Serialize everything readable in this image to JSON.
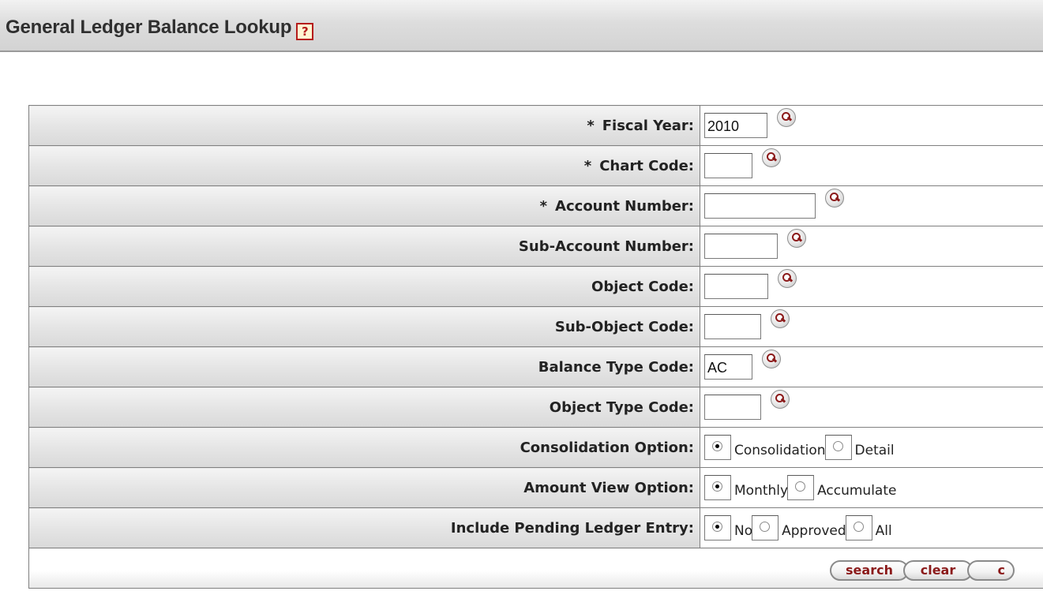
{
  "page": {
    "title": "General Ledger Balance Lookup",
    "help_icon": "?"
  },
  "form": {
    "rows": [
      {
        "label": "Fiscal Year:",
        "required": true,
        "value": "2010"
      },
      {
        "label": "Chart Code:",
        "required": true,
        "value": ""
      },
      {
        "label": "Account Number:",
        "required": true,
        "value": ""
      },
      {
        "label": "Sub-Account Number:",
        "required": false,
        "value": ""
      },
      {
        "label": "Object Code:",
        "required": false,
        "value": ""
      },
      {
        "label": "Sub-Object Code:",
        "required": false,
        "value": ""
      },
      {
        "label": "Balance Type Code:",
        "required": false,
        "value": "AC"
      },
      {
        "label": "Object Type Code:",
        "required": false,
        "value": ""
      }
    ],
    "required_marker": "*",
    "consolidation": {
      "label": "Consolidation Option:",
      "options": [
        "Consolidation",
        "Detail"
      ],
      "selected": "Consolidation"
    },
    "amount_view": {
      "label": "Amount View Option:",
      "options": [
        "Monthly",
        "Accumulate"
      ],
      "selected": "Monthly"
    },
    "pending": {
      "label": "Include Pending Ledger Entry:",
      "options": [
        "No",
        "Approved",
        "All"
      ],
      "selected": "No"
    }
  },
  "buttons": {
    "search": "search",
    "clear": "clear",
    "cancel": "c"
  },
  "icons": {
    "lookup": "magnifier-icon",
    "help": "help-icon",
    "radio": "radio-button"
  },
  "colors": {
    "accent": "#8b1a1a",
    "label_bg": "#e5e5e5"
  }
}
